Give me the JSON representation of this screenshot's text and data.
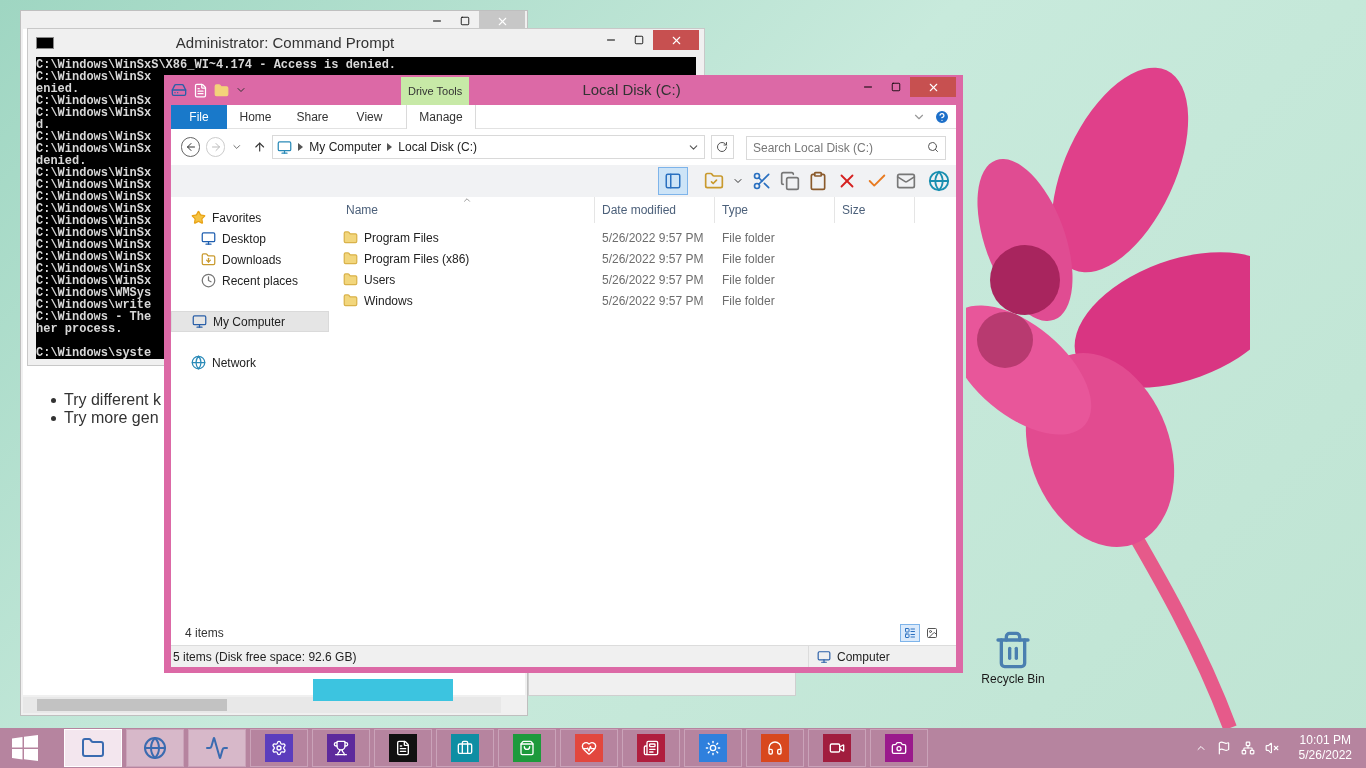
{
  "browser_window": {
    "bullets": [
      "Try different k",
      "Try more gen"
    ]
  },
  "command_prompt": {
    "title": "Administrator: Command Prompt",
    "lines": [
      "C:\\Windows\\WinSxS\\X86_WI~4.174 - Access is denied.",
      "C:\\Windows\\WinSx",
      "enied.",
      "C:\\Windows\\WinSx",
      "C:\\Windows\\WinSx",
      "d.",
      "C:\\Windows\\WinSx",
      "C:\\Windows\\WinSx",
      "denied.",
      "C:\\Windows\\WinSx",
      "C:\\Windows\\WinSx",
      "C:\\Windows\\WinSx",
      "C:\\Windows\\WinSx",
      "C:\\Windows\\WinSx",
      "C:\\Windows\\WinSx",
      "C:\\Windows\\WinSx",
      "C:\\Windows\\WinSx",
      "C:\\Windows\\WinSx",
      "C:\\Windows\\WinSx",
      "C:\\Windows\\WMSys",
      "C:\\Windows\\write",
      "C:\\Windows - The",
      "her process."
    ],
    "prompt_line": "C:\\Windows\\syste"
  },
  "explorer": {
    "title": "Local Disk (C:)",
    "context_tab": "Drive Tools",
    "ribbon_tabs": [
      {
        "label": "File",
        "kind": "file"
      },
      {
        "label": "Home",
        "kind": "tab"
      },
      {
        "label": "Share",
        "kind": "tab"
      },
      {
        "label": "View",
        "kind": "tab"
      },
      {
        "label": "Manage",
        "kind": "context"
      }
    ],
    "breadcrumb": [
      "My Computer",
      "Local Disk (C:)"
    ],
    "search": {
      "placeholder": "Search Local Disk (C:)"
    },
    "nav": [
      {
        "label": "Favorites",
        "selected": false,
        "children": [
          {
            "label": "Desktop",
            "selected": false
          },
          {
            "label": "Downloads",
            "selected": false
          },
          {
            "label": "Recent places",
            "selected": false
          }
        ]
      },
      {
        "label": "My Computer",
        "selected": true
      },
      {
        "label": "Network",
        "selected": false
      }
    ],
    "columns": [
      "Name",
      "Date modified",
      "Type",
      "Size"
    ],
    "rows": [
      {
        "name": "Program Files",
        "date": "5/26/2022 9:57 PM",
        "type": "File folder"
      },
      {
        "name": "Program Files (x86)",
        "date": "5/26/2022 9:57 PM",
        "type": "File folder"
      },
      {
        "name": "Users",
        "date": "5/26/2022 9:57 PM",
        "type": "File folder"
      },
      {
        "name": "Windows",
        "date": "5/26/2022 9:57 PM",
        "type": "File folder"
      }
    ],
    "item_count": "4 items",
    "status_bar": {
      "left": "5 items (Disk free space: 92.6 GB)",
      "right": "Computer"
    }
  },
  "desktop_icons": [
    {
      "label": "Recycle Bin"
    }
  ],
  "taskbar": {
    "apps": [
      {
        "kind": "desktop",
        "selected": true,
        "color": "#f3e6ee"
      },
      {
        "kind": "desktop",
        "selected": false,
        "color": "#d7b8c9"
      },
      {
        "kind": "desktop",
        "selected": false,
        "color": "#d7b8c9"
      },
      {
        "kind": "tile",
        "selected": false,
        "color": "#5b3dbd"
      },
      {
        "kind": "tile",
        "selected": false,
        "color": "#5d2a9c"
      },
      {
        "kind": "tile",
        "selected": false,
        "color": "#111111"
      },
      {
        "kind": "tile",
        "selected": false,
        "color": "#0e8ea3"
      },
      {
        "kind": "tile",
        "selected": false,
        "color": "#1d9a3c"
      },
      {
        "kind": "tile",
        "selected": false,
        "color": "#e2473e"
      },
      {
        "kind": "tile",
        "selected": false,
        "color": "#b01e3e"
      },
      {
        "kind": "tile",
        "selected": false,
        "color": "#2f80dd"
      },
      {
        "kind": "tile",
        "selected": false,
        "color": "#d8481e"
      },
      {
        "kind": "tile",
        "selected": false,
        "color": "#a11d3e"
      },
      {
        "kind": "tile",
        "selected": false,
        "color": "#9a1a8c"
      }
    ],
    "time": "10:01 PM",
    "date": "5/26/2022"
  }
}
